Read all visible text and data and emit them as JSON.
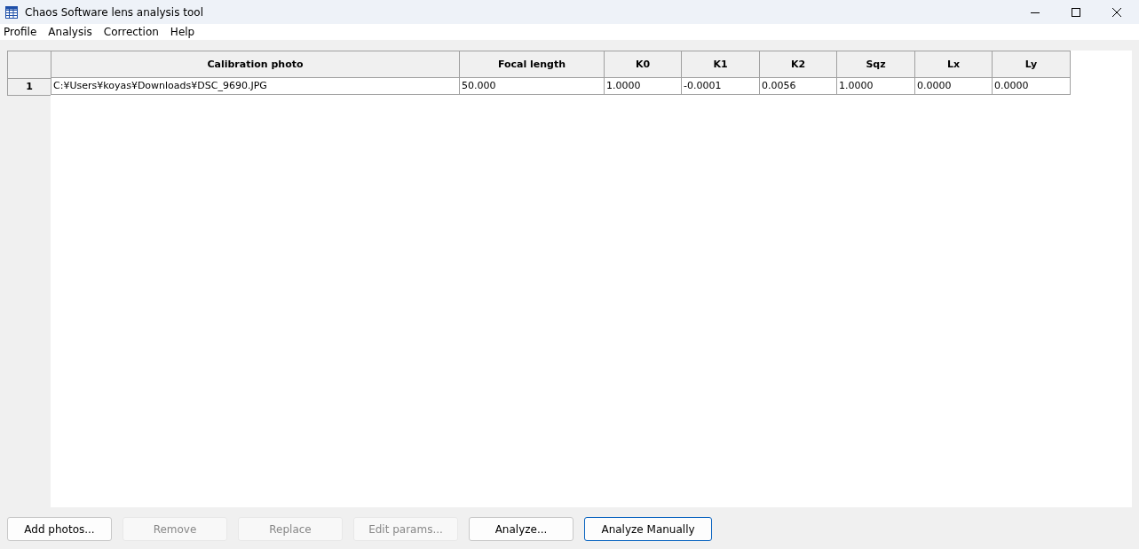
{
  "window": {
    "title": "Chaos Software lens analysis tool"
  },
  "menu": [
    "Profile",
    "Analysis",
    "Correction",
    "Help"
  ],
  "table": {
    "columns": [
      "Calibration photo",
      "Focal length",
      "K0",
      "K1",
      "K2",
      "Sqz",
      "Lx",
      "Ly"
    ],
    "rows": [
      {
        "number": "1",
        "cells": [
          "C:¥Users¥koyas¥Downloads¥DSC_9690.JPG",
          "50.000",
          "1.0000",
          "-0.0001",
          "0.0056",
          "1.0000",
          "0.0000",
          "0.0000"
        ]
      }
    ]
  },
  "buttons": [
    {
      "label": "Add photos...",
      "disabled": false,
      "focused": false
    },
    {
      "label": "Remove",
      "disabled": true,
      "focused": false
    },
    {
      "label": "Replace",
      "disabled": true,
      "focused": false
    },
    {
      "label": "Edit params...",
      "disabled": true,
      "focused": false
    },
    {
      "label": "Analyze...",
      "disabled": false,
      "focused": false
    },
    {
      "label": "Analyze Manually",
      "disabled": false,
      "focused": true
    }
  ]
}
